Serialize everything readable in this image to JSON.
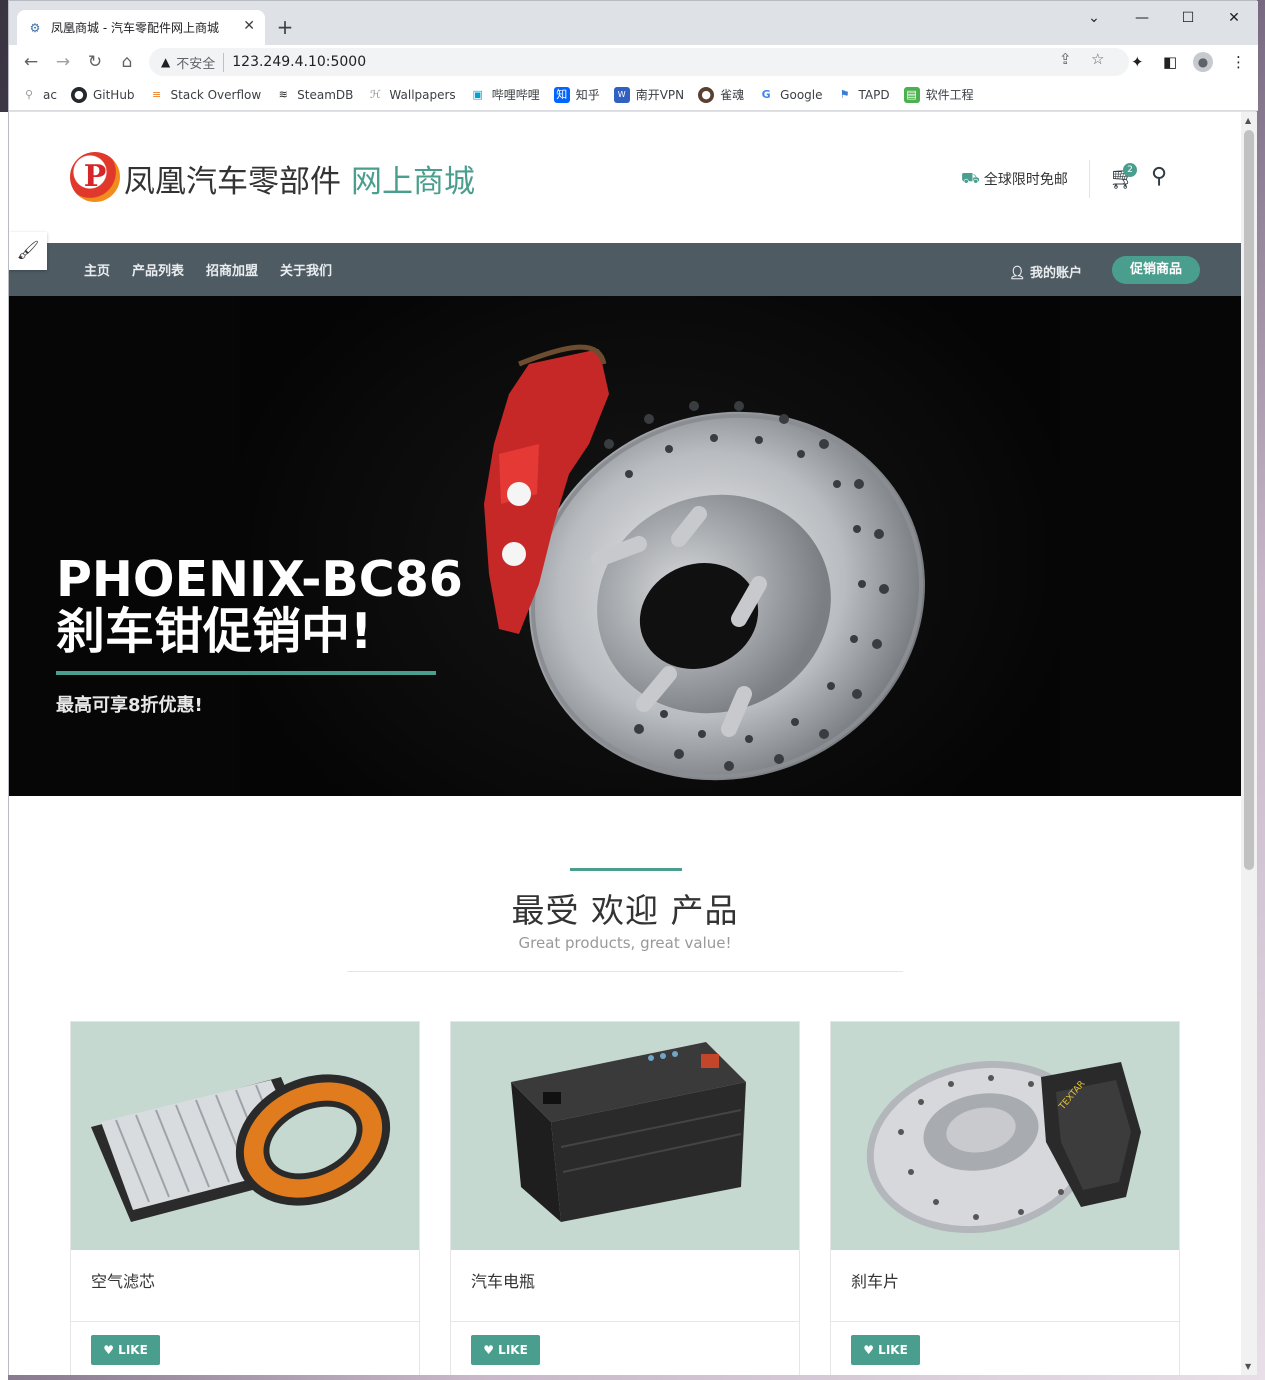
{
  "browser": {
    "tab_title": "凤凰商城 - 汽车零配件网上商城",
    "tab_close": "✕",
    "new_tab": "+",
    "insecure_label": "不安全",
    "url": "123.249.4.10:5000",
    "bookmarks": [
      {
        "label": "ac",
        "icon": "ac-icon"
      },
      {
        "label": "GitHub",
        "icon": "github-icon"
      },
      {
        "label": "Stack Overflow",
        "icon": "stackoverflow-icon"
      },
      {
        "label": "SteamDB",
        "icon": "steamdb-icon"
      },
      {
        "label": "Wallpapers",
        "icon": "wallpapers-icon"
      },
      {
        "label": "哔哩哔哩",
        "icon": "bilibili-icon"
      },
      {
        "label": "知乎",
        "icon": "zhihu-icon"
      },
      {
        "label": "南开VPN",
        "icon": "vpn-icon"
      },
      {
        "label": "雀魂",
        "icon": "mahjong-icon"
      },
      {
        "label": "Google",
        "icon": "google-icon"
      },
      {
        "label": "TAPD",
        "icon": "tapd-icon"
      },
      {
        "label": "软件工程",
        "icon": "book-icon"
      }
    ]
  },
  "site": {
    "logo_letter": "P",
    "logo_main": "凤凰汽车零部件",
    "logo_accent": "网上商城",
    "shipping": "全球限时免邮",
    "cart_count": "2",
    "nav": [
      "主页",
      "产品列表",
      "招商加盟",
      "关于我们"
    ],
    "account": "我的账户",
    "promo_button": "促销商品",
    "accent_color": "#4a9e8e",
    "nav_color": "#4f5b63"
  },
  "hero": {
    "title_line1": "PHOENIX-BC86",
    "title_line2": "刹车钳促销中!",
    "subtitle": "最高可享8折优惠!"
  },
  "popular": {
    "title": "最受 欢迎 产品",
    "subtitle": "Great products, great value!",
    "products": [
      {
        "name": "空气滤芯",
        "like": "LIKE"
      },
      {
        "name": "汽车电瓶",
        "like": "LIKE"
      },
      {
        "name": "刹车片",
        "like": "LIKE"
      }
    ]
  }
}
